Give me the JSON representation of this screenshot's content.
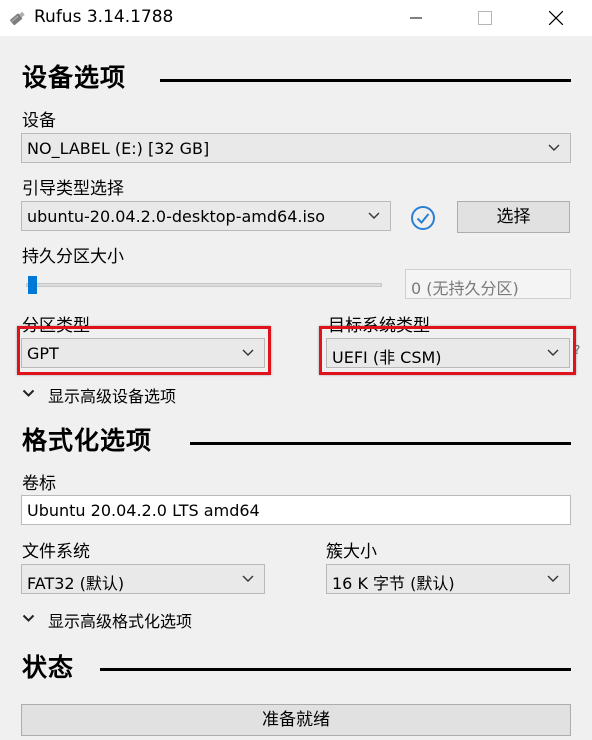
{
  "window": {
    "title": "Rufus 3.14.1788",
    "icon": "usb-drive-icon",
    "controls": [
      "minimize-icon",
      "maximize-icon",
      "close-icon"
    ]
  },
  "device_options": {
    "heading": "设备选项",
    "device_label": "设备",
    "device_value": "NO_LABEL (E:) [32 GB]",
    "boot_label": "引导类型选择",
    "boot_value": "ubuntu-20.04.2.0-desktop-amd64.iso",
    "verify_icon": "check-circle-icon",
    "select_button": "选择",
    "persistent_label": "持久分区大小",
    "persistent_value": "0 (无持久分区)",
    "partition_label": "分区类型",
    "partition_value": "GPT",
    "target_label": "目标系统类型",
    "target_value": "UEFI (非 CSM)",
    "target_help": "?",
    "advanced_toggle": "显示高级设备选项"
  },
  "format_options": {
    "heading": "格式化选项",
    "volume_label": "卷标",
    "volume_value": "Ubuntu 20.04.2.0 LTS amd64",
    "fs_label": "文件系统",
    "fs_value": "FAT32 (默认)",
    "cluster_label": "簇大小",
    "cluster_value": "16 K 字节 (默认)",
    "advanced_toggle": "显示高级格式化选项"
  },
  "status": {
    "heading": "状态",
    "progress_text": "准备就绪",
    "progress_fraction": 0
  },
  "highlight_color": "#e0131d",
  "accent_color": "#0078d7"
}
